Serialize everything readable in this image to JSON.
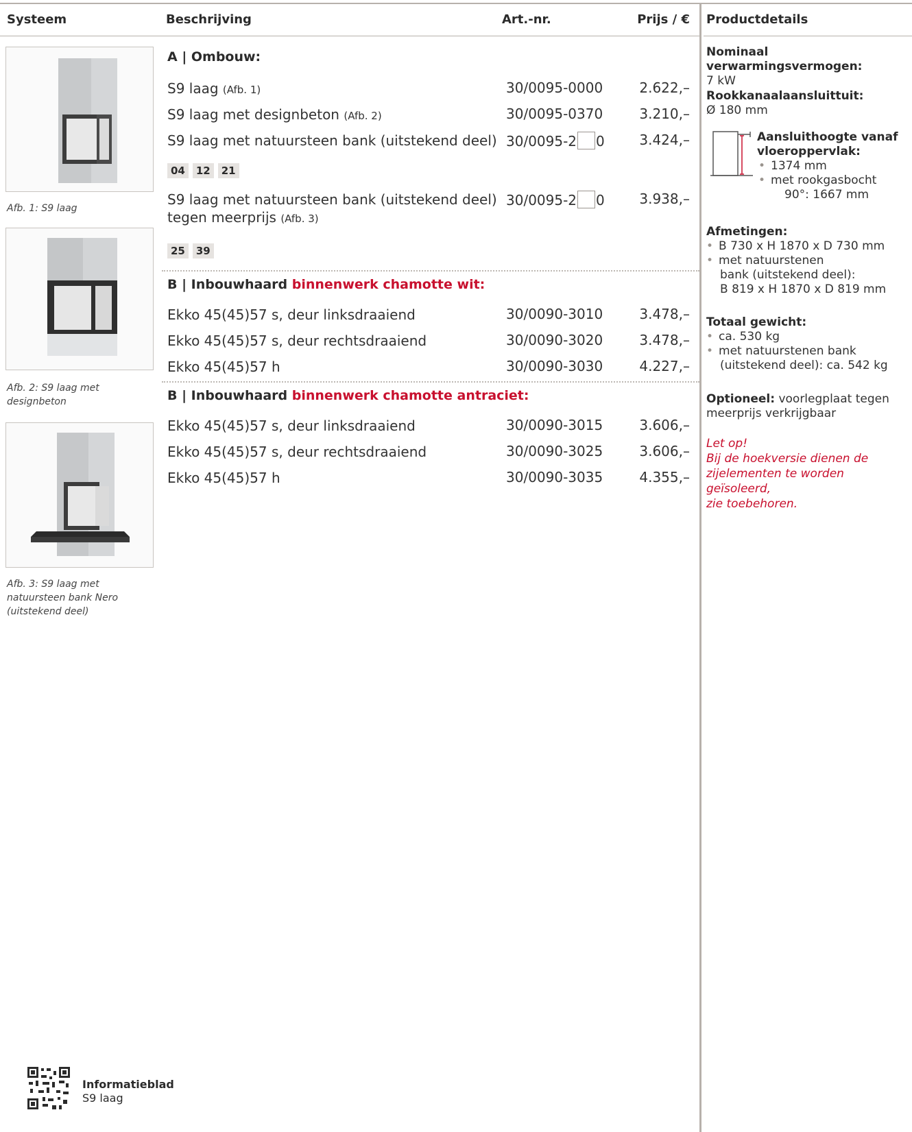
{
  "header": {
    "col_systeem": "Systeem",
    "col_beschrijving": "Beschrijving",
    "col_art": "Art.-nr.",
    "col_prijs": "Prijs / €",
    "col_details": "Productdetails"
  },
  "images": [
    {
      "caption": "Afb. 1: S9 laag"
    },
    {
      "caption": "Afb. 2: S9 laag met designbeton"
    },
    {
      "caption": "Afb. 3: S9 laag met natuursteen bank Nero (uitstekend deel)"
    }
  ],
  "sectionA": {
    "title": "A | Ombouw:",
    "rows": [
      {
        "desc": "S9 laag",
        "ref": "(Afb. 1)",
        "art": "30/0095-0000",
        "price": "2.622,–"
      },
      {
        "desc": "S9 laag met designbeton",
        "ref": "(Afb. 2)",
        "art": "30/0095-0370",
        "price": "3.210,–"
      },
      {
        "desc": "S9 laag met natuursteen bank (uitstekend deel)",
        "ref": "",
        "art_prefix": "30/0095-2",
        "art_suffix": "0",
        "price": "3.424,–"
      },
      {
        "desc_line1": "S9 laag met natuursteen bank (uitstekend deel)",
        "desc_line2": "tegen meerprijs",
        "ref": "(Afb. 3)",
        "art_prefix": "30/0095-2",
        "art_suffix": "0",
        "price": "3.938,–"
      }
    ],
    "chips1": [
      "04",
      "12",
      "21"
    ],
    "chips2": [
      "25",
      "39"
    ]
  },
  "sectionB1": {
    "prefix": "B | Inbouwhaard",
    "highlight": "binnenwerk chamotte wit:",
    "rows": [
      {
        "desc": "Ekko 45(45)57 s, deur linksdraaiend",
        "art": "30/0090-3010",
        "price": "3.478,–"
      },
      {
        "desc": "Ekko 45(45)57 s, deur rechtsdraaiend",
        "art": "30/0090-3020",
        "price": "3.478,–"
      },
      {
        "desc": "Ekko 45(45)57 h",
        "art": "30/0090-3030",
        "price": "4.227,–"
      }
    ]
  },
  "sectionB2": {
    "prefix": "B | Inbouwhaard",
    "highlight": "binnenwerk chamotte antraciet:",
    "rows": [
      {
        "desc": "Ekko 45(45)57 s, deur linksdraaiend",
        "art": "30/0090-3015",
        "price": "3.606,–"
      },
      {
        "desc": "Ekko 45(45)57 s, deur rechtsdraaiend",
        "art": "30/0090-3025",
        "price": "3.606,–"
      },
      {
        "desc": "Ekko 45(45)57 h",
        "art": "30/0090-3035",
        "price": "4.355,–"
      }
    ]
  },
  "details": {
    "power_label": "Nominaal verwarmingsvermogen:",
    "power_value": "7 kW",
    "flue_label": "Rookkanaalaansluittuit:",
    "flue_value": "Ø 180 mm",
    "height_label_1": "Aansluithoogte vanaf",
    "height_label_2": "vloeroppervlak:",
    "height_item1": "1374 mm",
    "height_item2_1": "met rookgasbocht",
    "height_item2_2": "90°: 1667 mm",
    "dim_label": "Afmetingen:",
    "dim_item1": "B 730 x H 1870 x D 730 mm",
    "dim_item2_1": "met natuurstenen",
    "dim_item2_2": "bank (uitstekend deel):",
    "dim_item2_3": "B 819 x H 1870 x D 819 mm",
    "weight_label": "Totaal gewicht:",
    "weight_item1": "ca. 530 kg",
    "weight_item2_1": "met natuurstenen bank",
    "weight_item2_2": "(uitstekend deel): ca. 542 kg",
    "optional_label": "Optioneel:",
    "optional_text_1": "voorlegplaat tegen",
    "optional_text_2": "meerprijs verkrijgbaar",
    "note_1": "Let op!",
    "note_2": "Bij de hoekversie dienen de",
    "note_3": "zijelementen te worden geïsoleerd,",
    "note_4": "zie toebehoren."
  },
  "footer": {
    "title": "Informatieblad",
    "subtitle": "S9 laag"
  }
}
